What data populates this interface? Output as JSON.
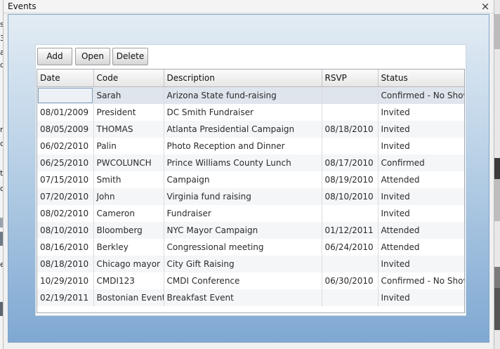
{
  "window": {
    "title": "Events",
    "close_glyph": "×"
  },
  "toolbar": {
    "add_label": "Add",
    "open_label": "Open",
    "delete_label": "Delete"
  },
  "table": {
    "columns": [
      "Date",
      "Code",
      "Description",
      "RSVP",
      "Status"
    ],
    "rows": [
      [
        "",
        "Sarah",
        "Arizona State fund-raising",
        "",
        "Confirmed - No Show"
      ],
      [
        "08/01/2009",
        "President",
        "DC Smith Fundraiser",
        "",
        "Invited"
      ],
      [
        "08/05/2009",
        "THOMAS",
        "Atlanta Presidential Campaign",
        "08/18/2010",
        "Invited"
      ],
      [
        "06/02/2010",
        "Palin",
        "Photo Reception and Dinner",
        "",
        "Invited"
      ],
      [
        "06/25/2010",
        "PWCOLUNCH",
        "Prince Williams County Lunch",
        "08/17/2010",
        "Confirmed"
      ],
      [
        "07/15/2010",
        "Smith",
        "Campaign",
        "08/19/2010",
        "Attended"
      ],
      [
        "07/20/2010",
        "John",
        "Virginia fund raising",
        "08/10/2010",
        "Invited"
      ],
      [
        "08/02/2010",
        "Cameron",
        "Fundraiser",
        "",
        "Invited"
      ],
      [
        "08/10/2010",
        "Bloomberg",
        "NYC Mayor Campaign",
        "01/12/2011",
        "Attended"
      ],
      [
        "08/16/2010",
        "Berkley",
        "Congressional meeting",
        "06/24/2010",
        "Attended"
      ],
      [
        "08/18/2010",
        "Chicago mayor",
        "City Gift Raising",
        "",
        "Invited"
      ],
      [
        "10/29/2010",
        "CMDI123",
        "CMDI Conference",
        "06/30/2010",
        "Confirmed - No Show"
      ],
      [
        "02/19/2011",
        "Bostonian Event",
        "Breakfast Event",
        "",
        "Invited"
      ]
    ]
  },
  "background": {
    "left_fragments": [
      "s",
      "3",
      "a",
      "d-",
      "n",
      "co",
      "t",
      "o",
      "er"
    ]
  }
}
